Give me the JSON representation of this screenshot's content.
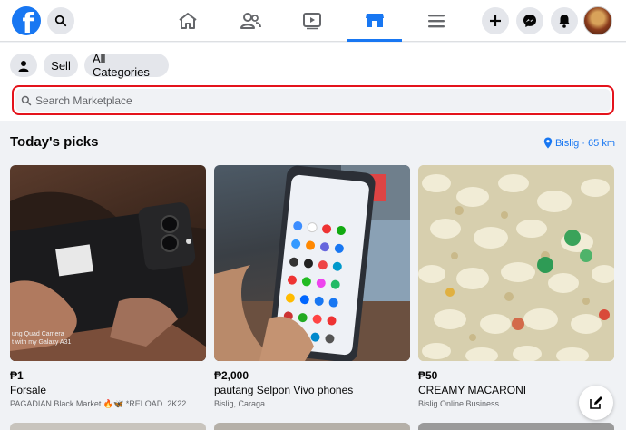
{
  "nav": {
    "logo_letter": "f",
    "tabs": [
      "home",
      "friends",
      "watch",
      "marketplace",
      "menu"
    ],
    "active_tab": "marketplace"
  },
  "marketplace": {
    "sell_label": "Sell",
    "categories_label": "All Categories",
    "search_placeholder": "Search Marketplace"
  },
  "picks": {
    "title": "Today's picks",
    "location": "Bislig · 65 km"
  },
  "listings": [
    {
      "price": "₱1",
      "title": "Forsale",
      "location": "PAGADIAN Black Market 🔥🦋 *RELOAD. 2K22...",
      "image_caption": "ung Quad Camera\nt with my Galaxy A31"
    },
    {
      "price": "₱2,000",
      "title": "pautang Selpon Vivo phones",
      "location": "Bislig, Caraga"
    },
    {
      "price": "₱50",
      "title": "CREAMY MACARONI",
      "location": "Bislig Online Business"
    }
  ],
  "colors": {
    "brand": "#1877f2",
    "search_highlight": "#e4131c",
    "background": "#f0f2f5"
  }
}
